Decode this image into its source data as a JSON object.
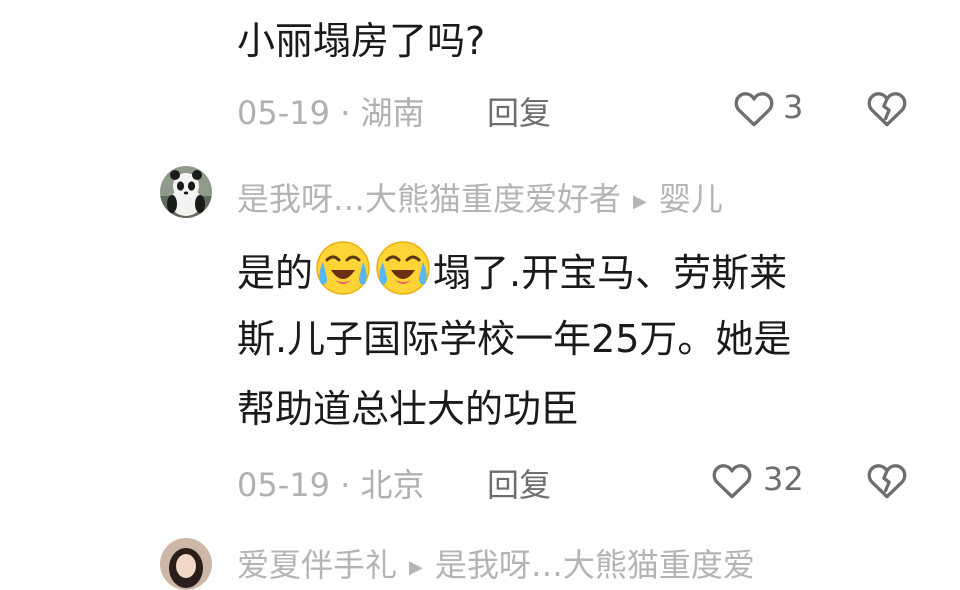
{
  "comment1": {
    "text": "小丽塌房了吗?",
    "date": "05-19",
    "sep": "·",
    "location": "湖南",
    "reply_label": "回复",
    "likes": "3"
  },
  "comment2": {
    "author": "是我呀…大熊猫重度爱好者",
    "reply_to": "婴儿",
    "line1_before": "是的",
    "line1_after": "塌了.开宝马、劳斯莱",
    "line2": "斯.儿子国际学校一年25万。她是",
    "line3": "帮助道总壮大的功臣",
    "emoji": "crying-laughing-emoji",
    "date": "05-19",
    "sep": "·",
    "location": "北京",
    "reply_label": "回复",
    "likes": "32"
  },
  "comment3": {
    "author": "爱夏伴手礼",
    "reply_to": "是我呀…大熊猫重度爱"
  },
  "colors": {
    "primary_text": "#1a1a1a",
    "meta_text": "#b0b0b0",
    "action_text": "#6e6e6e"
  }
}
